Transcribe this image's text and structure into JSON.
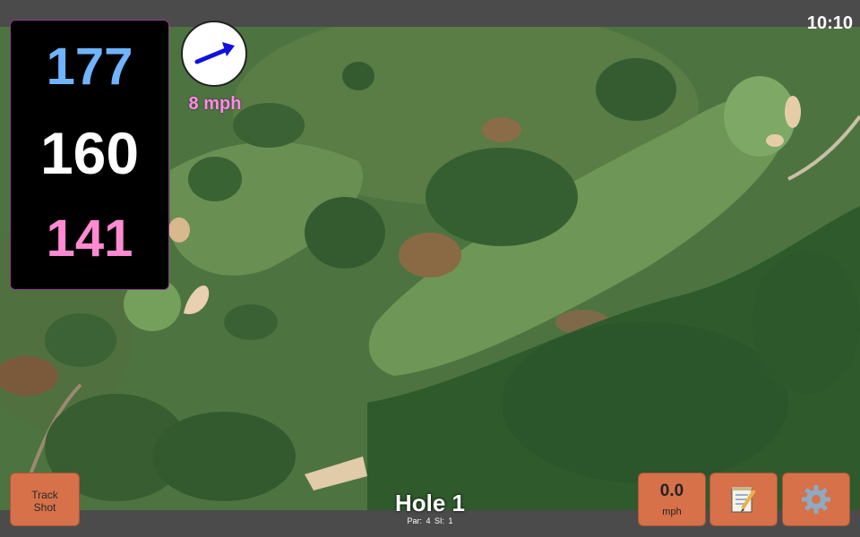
{
  "status_bar": {
    "time": "10:10"
  },
  "distances": {
    "back": "177",
    "center": "160",
    "front": "141"
  },
  "wind": {
    "speed": "8 mph",
    "icon": "arrow-right-up-icon"
  },
  "buttons": {
    "track_shot": "Track\nShot",
    "speed_value": "0.0",
    "speed_unit": "mph",
    "notes_icon": "notepad-icon",
    "settings_icon": "gear-icon"
  },
  "hole": {
    "title": "Hole 1",
    "par": "Par: 4",
    "si": "SI: 1"
  },
  "colors": {
    "back_distance": "#6fb4ff",
    "center_distance": "#ffffff",
    "front_distance": "#ff8ad2",
    "wind_text": "#ff8be6",
    "button": "#d6714a"
  }
}
